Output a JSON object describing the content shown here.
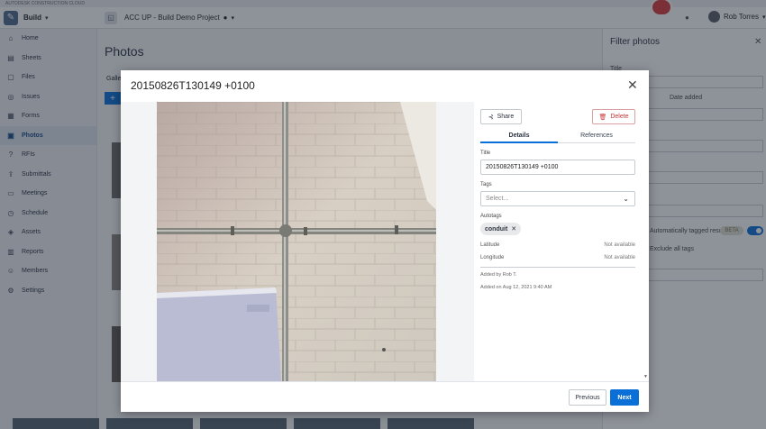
{
  "brand_strip": "AUTODESK CONSTRUCTION CLOUD",
  "app": {
    "product": "Build",
    "project": "ACC UP - Build Demo Project",
    "user": "Rob Torres"
  },
  "nav": [
    {
      "label": "Home",
      "icon": "home-icon",
      "glyph": "⌂"
    },
    {
      "label": "Sheets",
      "icon": "sheets-icon",
      "glyph": "▤"
    },
    {
      "label": "Files",
      "icon": "files-icon",
      "glyph": "▢"
    },
    {
      "label": "Issues",
      "icon": "issues-icon",
      "glyph": "◎"
    },
    {
      "label": "Forms",
      "icon": "forms-icon",
      "glyph": "▦"
    },
    {
      "label": "Photos",
      "icon": "photos-icon",
      "glyph": "▣",
      "active": true
    },
    {
      "label": "RFIs",
      "icon": "rfis-icon",
      "glyph": "?"
    },
    {
      "label": "Submittals",
      "icon": "submittals-icon",
      "glyph": "⇪"
    },
    {
      "label": "Meetings",
      "icon": "meetings-icon",
      "glyph": "▭"
    },
    {
      "label": "Schedule",
      "icon": "schedule-icon",
      "glyph": "◷"
    },
    {
      "label": "Assets",
      "icon": "assets-icon",
      "glyph": "◈"
    },
    {
      "label": "Reports",
      "icon": "reports-icon",
      "glyph": "▥"
    },
    {
      "label": "Members",
      "icon": "members-icon",
      "glyph": "☺"
    },
    {
      "label": "Settings",
      "icon": "settings-icon",
      "glyph": "⚙"
    }
  ],
  "page": {
    "title": "Photos",
    "gallery_tab": "Gallery"
  },
  "filter": {
    "title": "Filter photos",
    "title_label": "Title",
    "date_added": "Date added",
    "auto_tagged": "Automatically tagged results",
    "beta": "BETA",
    "exclude_all": "Exclude all tags"
  },
  "modal": {
    "title": "20150826T130149 +0100",
    "share_label": "Share",
    "delete_label": "Delete",
    "tabs": [
      "Details",
      "References"
    ],
    "title_label": "Title",
    "title_value": "20150826T130149 +0100",
    "tags_label": "Tags",
    "tags_placeholder": "Select...",
    "autotags_label": "Autotags",
    "autotags": [
      "conduit"
    ],
    "latitude_label": "Latitude",
    "latitude_value": "Not available",
    "longitude_label": "Longitude",
    "longitude_value": "Not available",
    "added_by": "Added by Rob T.",
    "added_on": "Added on Aug 12, 2021 9:40 AM",
    "prev_label": "Previous",
    "next_label": "Next"
  }
}
